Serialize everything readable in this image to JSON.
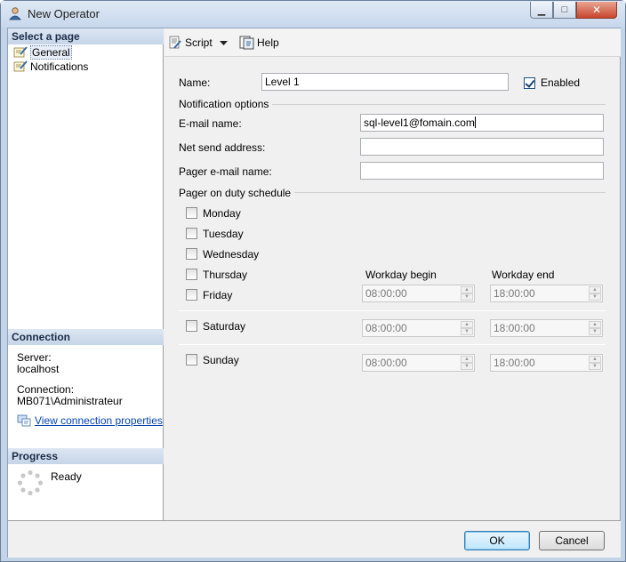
{
  "window": {
    "title": "New Operator",
    "min_glyph": "▁",
    "max_glyph": "□",
    "close_glyph": "✕"
  },
  "left": {
    "select_header": "Select a page",
    "pages": [
      "General",
      "Notifications"
    ],
    "connection_header": "Connection",
    "server_label": "Server:",
    "server_value": "localhost",
    "connection_label": "Connection:",
    "connection_value": "MB071\\Administrateur",
    "view_link": "View connection properties",
    "progress_header": "Progress",
    "progress_status": "Ready"
  },
  "toolbar": {
    "script_label": "Script",
    "help_label": "Help"
  },
  "form": {
    "name_label": "Name:",
    "name_value": "Level 1",
    "enabled_label": "Enabled",
    "enabled_checked": true,
    "notification_group": "Notification options",
    "email_label": "E-mail name:",
    "email_value": "sql-level1@fomain.com",
    "netsend_label": "Net send address:",
    "netsend_value": "",
    "pager_label": "Pager e-mail name:",
    "pager_value": "",
    "schedule_group": "Pager on duty schedule",
    "days": [
      "Monday",
      "Tuesday",
      "Wednesday",
      "Thursday",
      "Friday"
    ],
    "saturday": "Saturday",
    "sunday": "Sunday",
    "workday_begin_label": "Workday begin",
    "workday_end_label": "Workday end",
    "friday_begin": "08:00:00",
    "friday_end": "18:00:00",
    "saturday_begin": "08:00:00",
    "saturday_end": "18:00:00",
    "sunday_begin": "08:00:00",
    "sunday_end": "18:00:00"
  },
  "buttons": {
    "ok": "OK",
    "cancel": "Cancel"
  },
  "colors": {
    "section_header_text": "#1c2c48",
    "link": "#0645ad",
    "close_button": "#c8452c"
  }
}
